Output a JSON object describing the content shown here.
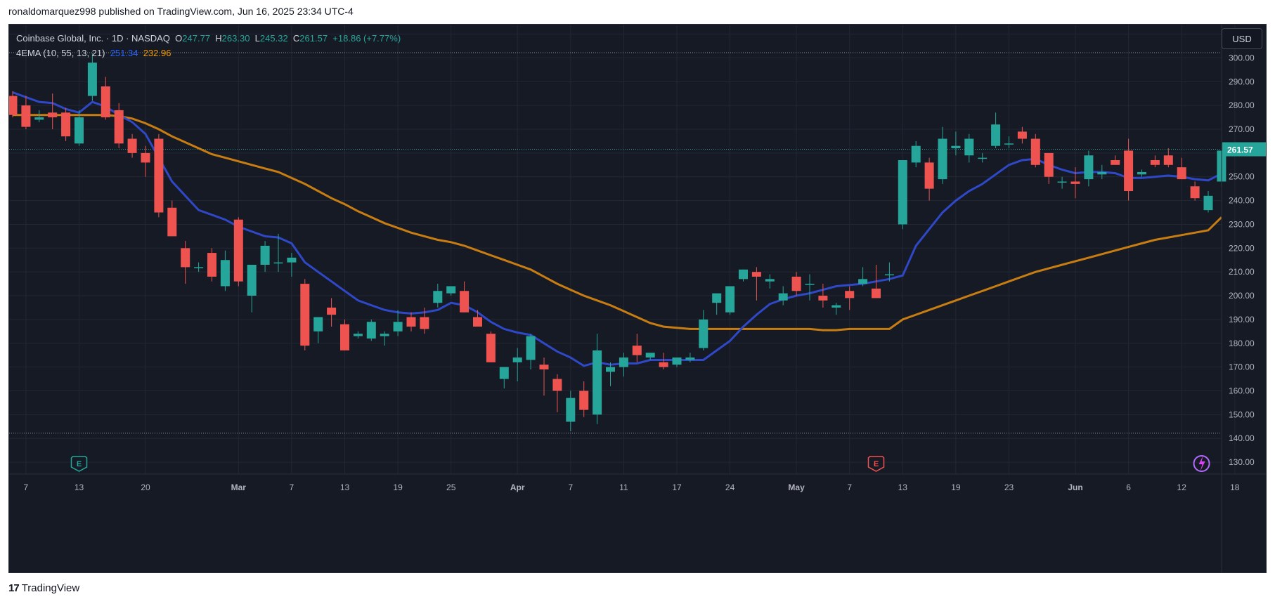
{
  "header": {
    "published_text": "ronaldomarquez998 published on TradingView.com, Jun 16, 2025 23:34 UTC-4"
  },
  "legend": {
    "symbol": "Coinbase Global, Inc. · 1D · NASDAQ",
    "o_label": "O",
    "o_value": "247.77",
    "h_label": "H",
    "h_value": "263.30",
    "l_label": "L",
    "l_value": "245.32",
    "c_label": "C",
    "c_value": "261.57",
    "change": "+18.86 (+7.77%)",
    "indicator": "4EMA (10, 55, 13, 21)",
    "ema_fast": "251.34",
    "ema_slow": "232.96"
  },
  "currency_button": "USD",
  "footer": {
    "brand": "TradingView",
    "logo_glyph": "17"
  },
  "colors": {
    "background": "#161a25",
    "up": "#26a69a",
    "down": "#ef5350",
    "ema_fast": "#2f48c7",
    "ema_slow": "#c77d12",
    "grid": "#232733",
    "text": "#b2b5be"
  },
  "icons": [
    "earnings-icon",
    "earnings-icon",
    "lightning-icon"
  ],
  "chart_data": {
    "type": "candlestick",
    "ylim": [
      125,
      314
    ],
    "y_ticks": [
      130,
      140,
      150,
      160,
      170,
      180,
      190,
      200,
      210,
      220,
      230,
      240,
      250,
      260,
      270,
      280,
      290,
      300,
      310
    ],
    "x_ticks": [
      {
        "label": "7",
        "i": 1
      },
      {
        "label": "13",
        "i": 5
      },
      {
        "label": "20",
        "i": 10
      },
      {
        "label": "Mar",
        "i": 17
      },
      {
        "label": "7",
        "i": 21
      },
      {
        "label": "13",
        "i": 25
      },
      {
        "label": "19",
        "i": 29
      },
      {
        "label": "25",
        "i": 33
      },
      {
        "label": "Apr",
        "i": 38
      },
      {
        "label": "7",
        "i": 42
      },
      {
        "label": "11",
        "i": 46
      },
      {
        "label": "17",
        "i": 50
      },
      {
        "label": "24",
        "i": 54
      },
      {
        "label": "May",
        "i": 59
      },
      {
        "label": "7",
        "i": 63
      },
      {
        "label": "13",
        "i": 67
      },
      {
        "label": "19",
        "i": 71
      },
      {
        "label": "23",
        "i": 75
      },
      {
        "label": "Jun",
        "i": 80
      },
      {
        "label": "6",
        "i": 84
      },
      {
        "label": "12",
        "i": 88
      },
      {
        "label": "18",
        "i": 92
      }
    ],
    "last_price": 261.57,
    "last_price_label": "261.57",
    "dotted_levels": [
      302.2,
      142.2
    ],
    "candles": [
      [
        0,
        284,
        286,
        275,
        276
      ],
      [
        1,
        280,
        284,
        270,
        271
      ],
      [
        2,
        274,
        278,
        273,
        275
      ],
      [
        3,
        277,
        285,
        270,
        275
      ],
      [
        4,
        277,
        279,
        265,
        267
      ],
      [
        5,
        264,
        278,
        263,
        275
      ],
      [
        6,
        284,
        302,
        282,
        298
      ],
      [
        7,
        288,
        292,
        274,
        275
      ],
      [
        8,
        278,
        281,
        262,
        264
      ],
      [
        9,
        266,
        268,
        258,
        260
      ],
      [
        10,
        260,
        263,
        250,
        256
      ],
      [
        11,
        266,
        268,
        233,
        235
      ],
      [
        12,
        237,
        240,
        225,
        225
      ],
      [
        13,
        220,
        223,
        205,
        212
      ],
      [
        14,
        212,
        214,
        210,
        212
      ],
      [
        15,
        218,
        220,
        206,
        208
      ],
      [
        16,
        204,
        219,
        202,
        215
      ],
      [
        17,
        232,
        233,
        204,
        206
      ],
      [
        18,
        200,
        212,
        193,
        213
      ],
      [
        19,
        213,
        223,
        210,
        221
      ],
      [
        20,
        214,
        226,
        210,
        214
      ],
      [
        21,
        214,
        218,
        208,
        216
      ],
      [
        22,
        205,
        207,
        177,
        179
      ],
      [
        23,
        185,
        190,
        180,
        191
      ],
      [
        24,
        195,
        199,
        187,
        192
      ],
      [
        25,
        188,
        190,
        177,
        177
      ],
      [
        26,
        183,
        185,
        182,
        184
      ],
      [
        27,
        182,
        190,
        181,
        189
      ],
      [
        28,
        183,
        185,
        179,
        184
      ],
      [
        29,
        185,
        194,
        183,
        189
      ],
      [
        30,
        191,
        193,
        185,
        187
      ],
      [
        31,
        191,
        195,
        184,
        186
      ],
      [
        32,
        197,
        205,
        195,
        202
      ],
      [
        33,
        201,
        204,
        200,
        204
      ],
      [
        34,
        202,
        206,
        193,
        193
      ],
      [
        35,
        191,
        194,
        187,
        187
      ],
      [
        36,
        184,
        185,
        172,
        172
      ],
      [
        37,
        165,
        169,
        161,
        170
      ],
      [
        38,
        172,
        178,
        164,
        174
      ],
      [
        39,
        173,
        184,
        169,
        183
      ],
      [
        40,
        171,
        174,
        158,
        169
      ],
      [
        41,
        165,
        167,
        151,
        160
      ],
      [
        42,
        147,
        160,
        143,
        157
      ],
      [
        43,
        160,
        164,
        149,
        152
      ],
      [
        44,
        150,
        184,
        146,
        177
      ],
      [
        45,
        168,
        172,
        162,
        170
      ],
      [
        46,
        170,
        176,
        166,
        174
      ],
      [
        47,
        179,
        184,
        172,
        175
      ],
      [
        48,
        174,
        176,
        173,
        176
      ],
      [
        49,
        172,
        176,
        169,
        170
      ],
      [
        50,
        171,
        174,
        170,
        174
      ],
      [
        51,
        173,
        176,
        172,
        174
      ],
      [
        52,
        178,
        194,
        177,
        190
      ],
      [
        53,
        197,
        200,
        192,
        201
      ],
      [
        54,
        193,
        204,
        192,
        204
      ],
      [
        55,
        207,
        211,
        206,
        211
      ],
      [
        56,
        210,
        212,
        198,
        208
      ],
      [
        57,
        206,
        209,
        203,
        207
      ],
      [
        58,
        198,
        204,
        196,
        201
      ],
      [
        59,
        208,
        210,
        200,
        202
      ],
      [
        60,
        205,
        209,
        198,
        205
      ],
      [
        61,
        200,
        205,
        195,
        198
      ],
      [
        62,
        195,
        197,
        192,
        196
      ],
      [
        63,
        202,
        204,
        194,
        199
      ],
      [
        64,
        205,
        212,
        204,
        207
      ],
      [
        65,
        203,
        213,
        199,
        199
      ],
      [
        66,
        209,
        214,
        206,
        209
      ],
      [
        67,
        230,
        247,
        228,
        257
      ],
      [
        68,
        256,
        265,
        254,
        263
      ],
      [
        69,
        256,
        258,
        240,
        245
      ],
      [
        70,
        249,
        271,
        247,
        266
      ],
      [
        71,
        262,
        269,
        259,
        263
      ],
      [
        72,
        259,
        268,
        256,
        266
      ],
      [
        73,
        258,
        260,
        256,
        258
      ],
      [
        74,
        263,
        277,
        262,
        272
      ],
      [
        75,
        264,
        267,
        262,
        264
      ],
      [
        76,
        269,
        271,
        264,
        266
      ],
      [
        77,
        266,
        268,
        254,
        255
      ],
      [
        78,
        260,
        260,
        247,
        250
      ],
      [
        79,
        248,
        250,
        245,
        248
      ],
      [
        80,
        248,
        254,
        241,
        247
      ],
      [
        81,
        249,
        261,
        246,
        259
      ],
      [
        82,
        251,
        255,
        249,
        252
      ],
      [
        83,
        257,
        259,
        255,
        255
      ],
      [
        84,
        261,
        266,
        240,
        244
      ],
      [
        85,
        251,
        253,
        250,
        252
      ],
      [
        86,
        257,
        259,
        254,
        255
      ],
      [
        87,
        259,
        262,
        254,
        255
      ],
      [
        88,
        254,
        258,
        249,
        249
      ],
      [
        89,
        246,
        248,
        240,
        241
      ],
      [
        90,
        236,
        244,
        235,
        242
      ],
      [
        91,
        248,
        264,
        246,
        261
      ]
    ],
    "ema_fast_series": [
      285.5,
      283.5,
      281.5,
      281,
      278.5,
      277,
      281.5,
      279.5,
      276,
      273,
      268,
      258,
      248,
      242,
      236,
      234,
      232,
      229,
      227,
      225,
      224.5,
      222,
      214,
      210,
      206,
      202,
      198,
      196,
      194,
      193,
      192.5,
      193,
      194,
      197,
      196,
      193,
      189,
      186,
      184.5,
      183.5,
      180,
      176.5,
      174,
      170.5,
      172,
      171,
      171.5,
      171.5,
      173,
      173,
      173,
      173,
      173,
      177,
      181,
      187,
      192,
      196.5,
      198.5,
      200,
      201,
      202.5,
      204,
      204.5,
      205,
      206,
      207,
      208.5,
      221,
      228,
      235,
      240,
      244,
      247,
      251,
      255,
      257,
      257.5,
      255,
      253,
      251.5,
      252,
      252,
      251.5,
      249.5,
      249.5,
      250,
      250.5,
      250,
      249,
      248.5,
      251.3
    ],
    "ema_slow_series": [
      276,
      276,
      276,
      276,
      276,
      276,
      276,
      276,
      275.5,
      274.5,
      272.5,
      270,
      267,
      264.5,
      262,
      259.5,
      258,
      256.5,
      255,
      253.5,
      252,
      249.5,
      247,
      244,
      241,
      238.5,
      235.5,
      233,
      230.5,
      228.5,
      226.5,
      225,
      223.5,
      222.5,
      221,
      219,
      217,
      215,
      213,
      211,
      208,
      205,
      202.5,
      200,
      198,
      196,
      193.5,
      191,
      188.5,
      187,
      186.5,
      186,
      186,
      186,
      186,
      186,
      186,
      186,
      186,
      186,
      186,
      185.5,
      185.5,
      186,
      186,
      186,
      186,
      190,
      192,
      194,
      196,
      198,
      200,
      202,
      204,
      206,
      208,
      210,
      211.5,
      213,
      214.5,
      216,
      217.5,
      219,
      220.5,
      222,
      223.5,
      224.5,
      225.5,
      226.5,
      227.5,
      233
    ]
  }
}
